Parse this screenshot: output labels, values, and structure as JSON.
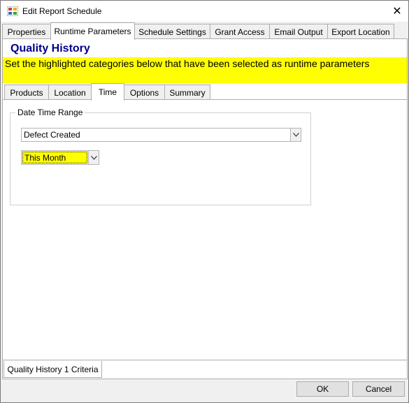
{
  "window": {
    "title": "Edit Report Schedule",
    "close_glyph": "✕"
  },
  "top_tabs": [
    {
      "label": "Properties"
    },
    {
      "label": "Runtime Parameters",
      "active": true
    },
    {
      "label": "Schedule Settings"
    },
    {
      "label": "Grant Access"
    },
    {
      "label": "Email Output"
    },
    {
      "label": "Export Location"
    }
  ],
  "report": {
    "title": "Quality History",
    "instructions": "Set the highlighted categories below that have been selected as runtime parameters"
  },
  "inner_tabs": [
    {
      "label": "Products"
    },
    {
      "label": "Location"
    },
    {
      "label": "Time",
      "active": true
    },
    {
      "label": "Options"
    },
    {
      "label": "Summary"
    }
  ],
  "time": {
    "group_label": "Date Time Range",
    "date_field": "Defect Created",
    "period": "This Month"
  },
  "criteria_tab": "Quality History 1 Criteria",
  "buttons": {
    "ok": "OK",
    "cancel": "Cancel"
  },
  "colors": {
    "highlight": "#ffff00",
    "title": "#00008b"
  }
}
